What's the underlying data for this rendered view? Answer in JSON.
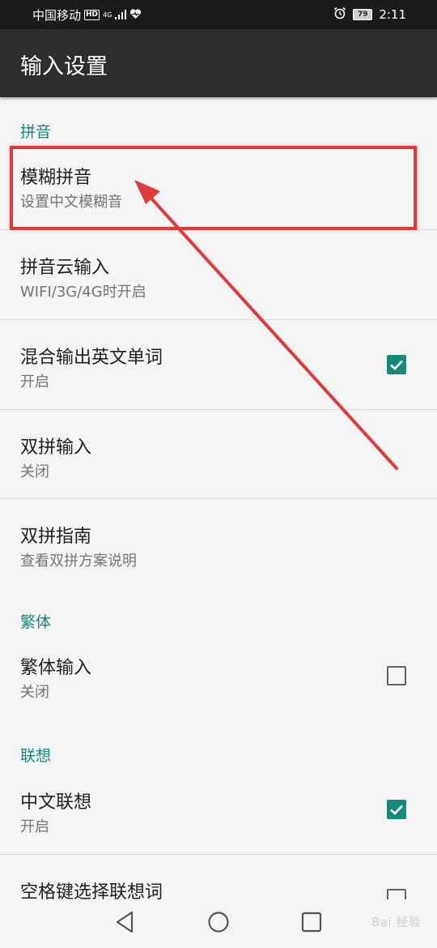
{
  "status_bar": {
    "carrier": "中国移动",
    "hd": "HD",
    "network": "4G",
    "battery": "79",
    "time": "2:11"
  },
  "app_bar": {
    "title": "输入设置"
  },
  "sections": [
    {
      "header": "拼音"
    },
    {
      "header": "繁体"
    },
    {
      "header": "联想"
    }
  ],
  "items": [
    {
      "title": "模糊拼音",
      "summary": "设置中文模糊音"
    },
    {
      "title": "拼音云输入",
      "summary": "WIFI/3G/4G时开启"
    },
    {
      "title": "混合输出英文单词",
      "summary": "开启",
      "checked": true
    },
    {
      "title": "双拼输入",
      "summary": "关闭"
    },
    {
      "title": "双拼指南",
      "summary": "查看双拼方案说明"
    },
    {
      "title": "繁体输入",
      "summary": "关闭",
      "checked": false
    },
    {
      "title": "中文联想",
      "summary": "开启",
      "checked": true
    },
    {
      "title": "空格键选择联想词",
      "checked": false
    }
  ],
  "navigation": {
    "buttons": [
      "back",
      "home",
      "recents"
    ]
  },
  "watermark": "Bai 经验",
  "colors": {
    "accent": "#16897b",
    "section_header": "#19877a",
    "annotation": "#e23a3a",
    "app_bar": "#2e2e2e"
  }
}
